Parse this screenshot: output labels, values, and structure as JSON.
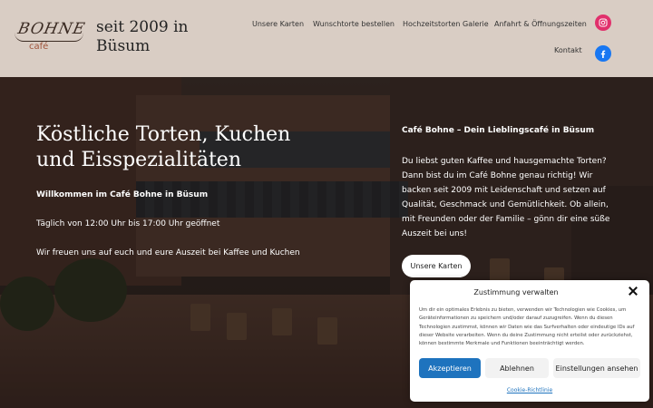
{
  "brand": {
    "logo_script": "BOHNE",
    "logo_sub": "café",
    "tagline": "seit 2009 in Büsum"
  },
  "nav": {
    "items": [
      {
        "label": "Unsere Karten"
      },
      {
        "label": "Wunschtorte bestellen"
      },
      {
        "label": "Hochzeitstorten Galerie"
      },
      {
        "label": "Anfahrt & Öffnungszeiten"
      },
      {
        "label": "Kontakt"
      }
    ],
    "social": [
      {
        "icon": "instagram-icon",
        "color": "#e1306c"
      },
      {
        "icon": "facebook-icon",
        "color": "#1877f2"
      }
    ]
  },
  "hero": {
    "title": "Köstliche Torten, Kuchen und Eisspezialitäten",
    "welcome": "Willkommen im Café Bohne in Büsum",
    "hours": "Täglich von 12:00 Uhr bis 17:00 Uhr geöffnet",
    "invite": "Wir freuen uns auf euch und eure Auszeit bei Kaffee und Kuchen",
    "right_heading": "Café Bohne – Dein Lieblingscafé in Büsum",
    "right_text": "Du liebst guten Kaffee und hausgemachte Torten? Dann bist du im Café Bohne genau richtig! Wir backen seit 2009 mit Leidenschaft und setzen auf Qualität, Geschmack und Gemütlichkeit. Ob allein, mit Freunden oder der Familie – gönn dir eine süße Auszeit bei uns!",
    "button_label": "Unsere Karten"
  },
  "cookie": {
    "title": "Zustimmung verwalten",
    "body": "Um dir ein optimales Erlebnis zu bieten, verwenden wir Technologien wie Cookies, um Geräteinformationen zu speichern und/oder darauf zuzugreifen. Wenn du diesen Technologien zustimmst, können wir Daten wie das Surfverhalten oder eindeutige IDs auf dieser Website verarbeiten. Wenn du deine Zustimmung nicht erteilst oder zurückziehst, können bestimmte Merkmale und Funktionen beeinträchtigt werden.",
    "accept_label": "Akzeptieren",
    "deny_label": "Ablehnen",
    "settings_label": "Einstellungen ansehen",
    "link_label": "Cookie-Richtlinie",
    "accent_color": "#1e73be"
  }
}
